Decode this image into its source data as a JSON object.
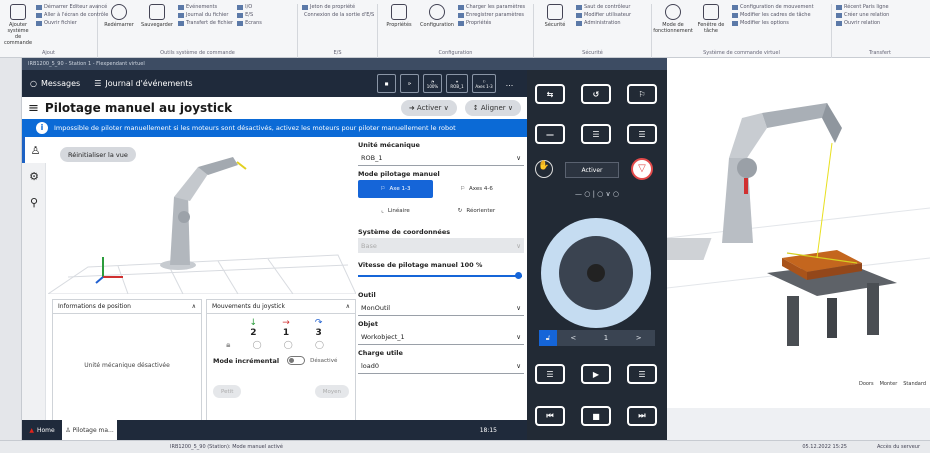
{
  "ribbon": {
    "groups": [
      {
        "name": "Ajout",
        "big": [
          "Ajouter système de commande"
        ],
        "items": [
          "Démarrer Editeur avancé",
          "Aller à l'écran de contrôle",
          "Ouvrir fichier"
        ]
      },
      {
        "name": "Outils système de commande",
        "big": [
          "Redémarrer",
          "Sauvegarder"
        ],
        "items": [
          "Evénements",
          "Journal du fichier",
          "Transfert de fichier"
        ],
        "items2": [
          "I/O",
          "E/S",
          "Ecrans"
        ]
      },
      {
        "name": "E/S",
        "big": [],
        "items": [
          "Jeton de propriété",
          "Connexion de la sortie d'E/S"
        ]
      },
      {
        "name": "Configuration",
        "big": [
          "Propriétés",
          "Configuration"
        ],
        "items": [
          "Charger les paramètres",
          "Enregistrer paramètres",
          "Propriétés"
        ]
      },
      {
        "name": "Sécurité",
        "big": [
          "Sécurité"
        ],
        "items": [
          "Saut de contrôleur",
          "Modifier utilisateur",
          "Administration"
        ]
      },
      {
        "name": "Système de commande virtuel",
        "big": [
          "Mode de fonctionnement",
          "Fenêtre de tâche"
        ],
        "items": [
          "Configuration de mouvement",
          "Modifier les cadres de tâche",
          "Modifier les options"
        ]
      },
      {
        "name": "Transfert",
        "big": [],
        "items": [
          "Récent Paris ligne",
          "Créer une relation",
          "Ouvrir relation"
        ]
      }
    ]
  },
  "window": {
    "title": "IRB1200_5_90 - Station 1 - Flexpendant virtuel"
  },
  "fp": {
    "top": {
      "messages": "Messages",
      "journal": "Journal d'événements",
      "speed": "100%",
      "rob": "ROB_1",
      "axes": "Axes 1-3",
      "more": "..."
    },
    "title": "Pilotage manuel au joystick",
    "activate": "Activer",
    "align": "Aligner",
    "alert": "Impossible de piloter manuellement si les moteurs sont désactivés, activez les moteurs pour piloter manuellement le robot",
    "reset_view": "Réinitialiser la vue",
    "pos_panel": {
      "title": "Informations de position",
      "status": "Unité mécanique désactivée"
    },
    "joy_panel": {
      "title": "Mouvements du joystick",
      "axes": [
        "2",
        "1",
        "3"
      ],
      "mode_label": "Mode incrémental",
      "mode_state": "Désactivé",
      "btn_left": "Petit",
      "btn_right": "Moyen"
    },
    "unit_label": "Unité mécanique",
    "unit_value": "ROB_1",
    "mode_label": "Mode pilotage manuel",
    "modes": [
      "Axe 1-3",
      "Axes 4-6",
      "Linéaire",
      "Réorienter"
    ],
    "coord_label": "Système de coordonnées",
    "coord_value": "Base",
    "speed_label": "Vitesse de pilotage manuel 100 %",
    "speed_fraction": 1.0,
    "tool_label": "Outil",
    "tool_value": "MonOutil",
    "obj_label": "Objet",
    "obj_value": "Workobject_1",
    "load_label": "Charge utile",
    "load_value": "load0",
    "nav": {
      "home": "Home",
      "tab": "Pilotage ma...",
      "clock": "18:15"
    }
  },
  "joy": {
    "activate": "Activer",
    "jog_symbols": "— ○ | ○ ∨ ○",
    "lock_values": [
      "<",
      "1",
      ">"
    ]
  },
  "viewport": {
    "bar": [
      "Doors",
      "Monter",
      "Standard"
    ]
  },
  "status": {
    "left": "IRB1200_5_90 (Station): Mode manuel activé",
    "date": "05.12.2022 15:25",
    "right": "Accès du serveur"
  },
  "colors": {
    "accent": "#1565d8",
    "dark": "#1f2a3b",
    "alert": "#0b6ad6"
  }
}
